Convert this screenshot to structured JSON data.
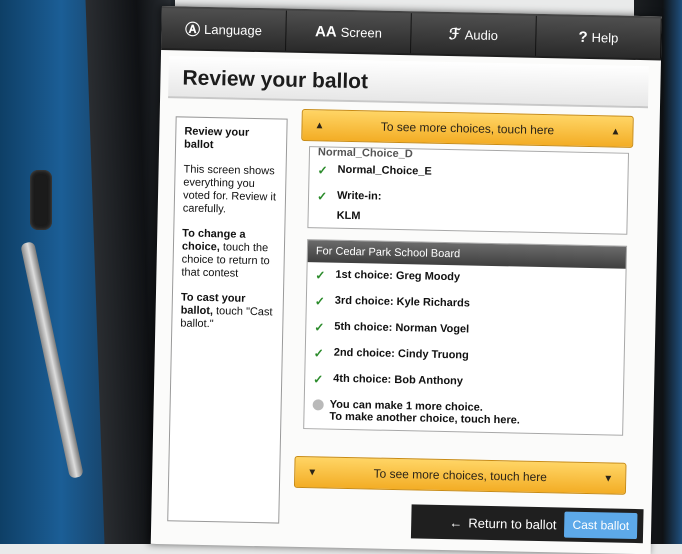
{
  "toolbar": {
    "language_label": "Language",
    "screen_label": "Screen",
    "audio_label": "Audio",
    "help_label": "Help"
  },
  "page": {
    "title": "Review your ballot"
  },
  "help_panel": {
    "heading": "Review your ballot",
    "para1": "This screen shows everything you voted for. Review it carefully.",
    "para2_bold": "To change a choice,",
    "para2_rest": " touch the choice to return to that contest",
    "para3_bold": "To cast your ballot,",
    "para3_rest": " touch \"Cast ballot.\""
  },
  "scroll_up_label": "To see more choices, touch here",
  "scroll_down_label": "To see more choices, touch here",
  "previous_contest": {
    "cut_off": "Normal_Choice_D",
    "choice_e": "Normal_Choice_E",
    "write_in_label": "Write-in:",
    "write_in_value": "KLM"
  },
  "school_board": {
    "header": "For Cedar Park School Board",
    "choices": [
      "1st choice: Greg Moody",
      "3rd choice: Kyle Richards",
      "5th choice: Norman Vogel",
      "2nd choice: Cindy Truong",
      "4th choice: Bob Anthony"
    ],
    "more_line1": "You can make 1 more choice.",
    "more_line2": "To make another choice, touch here."
  },
  "footer": {
    "return_label": "Return to ballot",
    "cast_label": "Cast ballot"
  },
  "icons": {
    "check": "✓",
    "arrow_left": "←",
    "tri_up": "▲",
    "tri_down": "▼"
  }
}
